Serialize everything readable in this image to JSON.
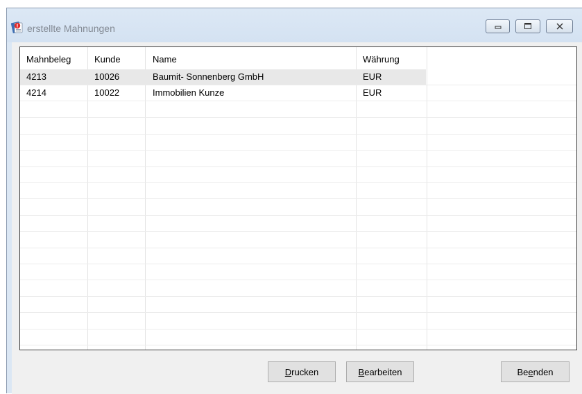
{
  "window": {
    "title": "erstellte Mahnungen"
  },
  "controls": {
    "minimize_icon": "minimize-icon",
    "maximize_icon": "maximize-icon",
    "close_icon": "close-icon"
  },
  "table": {
    "columns": [
      "Mahnbeleg",
      "Kunde",
      "Name",
      "Währung"
    ],
    "rows": [
      {
        "mahnbeleg": "4213",
        "kunde": "10026",
        "name": "Baumit- Sonnenberg GmbH",
        "waehrung": "EUR"
      },
      {
        "mahnbeleg": "4214",
        "kunde": "10022",
        "name": "Immobilien Kunze",
        "waehrung": "EUR"
      }
    ]
  },
  "buttons": {
    "print": {
      "accel": "D",
      "rest": "rucken"
    },
    "edit": {
      "accel": "B",
      "rest": "earbeiten"
    },
    "exit": {
      "pre": "Be",
      "accel": "e",
      "rest": "nden"
    }
  }
}
